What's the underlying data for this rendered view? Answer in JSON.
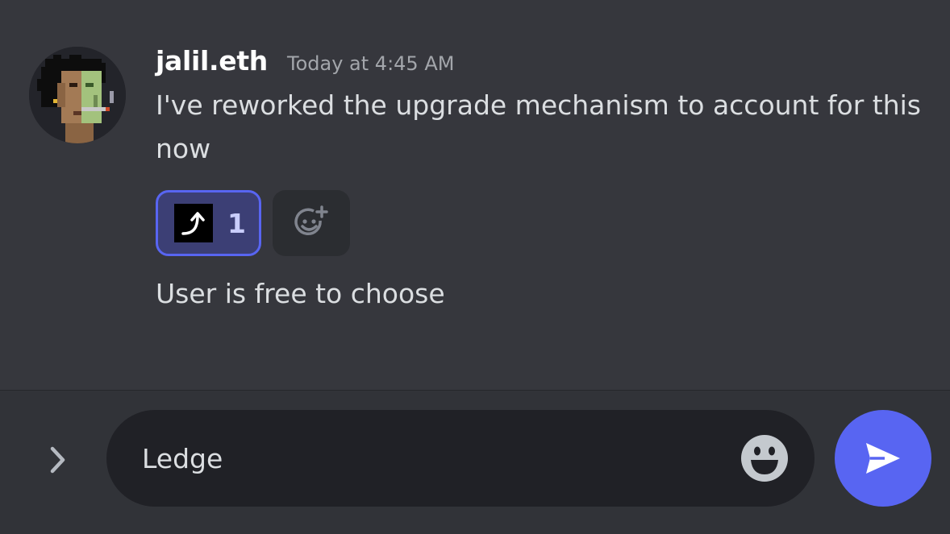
{
  "message": {
    "username": "jalil.eth",
    "timestamp": "Today at 4:45 AM",
    "text_1": "I've reworked the upgrade mechanism to account for this now",
    "text_2": "User is free to choose",
    "reaction": {
      "emoji_icon": "upward-arrow-icon",
      "count": "1"
    }
  },
  "composer": {
    "input_value": "Ledge"
  },
  "colors": {
    "accent": "#5865f2",
    "background": "#36373d"
  }
}
